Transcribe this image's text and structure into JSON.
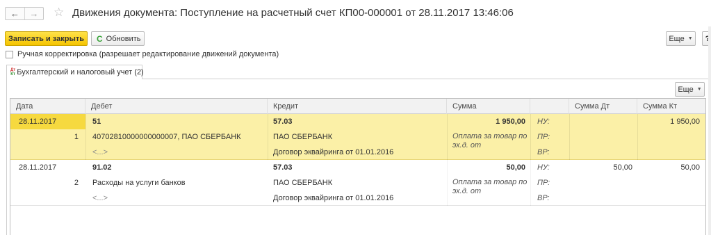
{
  "window": {
    "title": "Движения документа: Поступление на расчетный счет КП00-000001 от 28.11.2017 13:46:06"
  },
  "nav": {
    "back": "←",
    "forward": "→",
    "favorite": "☆"
  },
  "toolbar": {
    "save_close": "Записать и закрыть",
    "refresh": "Обновить",
    "more": "Еще",
    "help": "?"
  },
  "manual_edit": {
    "label": "Ручная корректировка (разрешает редактирование движений документа)",
    "checked": false
  },
  "tabs": [
    {
      "label": "Бухгалтерский и налоговый учет (2)",
      "icon": "accounting-dt-kt-icon",
      "icon_top": "Дт",
      "icon_bottom": "Кт"
    }
  ],
  "grid_toolbar": {
    "more": "Еще"
  },
  "columns": [
    "Дата",
    "Дебет",
    "Кредит",
    "Сумма",
    "",
    "Сумма Дт",
    "Сумма Кт"
  ],
  "rows": [
    {
      "date": "28.11.2017",
      "number": "1",
      "debit_account": "51",
      "debit_sub1": "40702810000000000007, ПАО СБЕРБАНК",
      "debit_sub2": "<...>",
      "credit_account": "57.03",
      "credit_sub1": "ПАО СБЕРБАНК",
      "credit_sub2": "Договор эквайринга от 01.01.2016",
      "amount": "1 950,00",
      "memo": "Оплата за товар по эх.д. от",
      "nu_label": "НУ:",
      "pr_label": "ПР:",
      "vr_label": "ВР:",
      "amount_dt": "",
      "amount_kt": "1 950,00",
      "selected": true
    },
    {
      "date": "28.11.2017",
      "number": "2",
      "debit_account": "91.02",
      "debit_sub1": "Расходы на услуги банков",
      "debit_sub2": "<...>",
      "credit_account": "57.03",
      "credit_sub1": "ПАО СБЕРБАНК",
      "credit_sub2": "Договор эквайринга от 01.01.2016",
      "amount": "50,00",
      "memo": "Оплата за товар по эх.д. от",
      "nu_label": "НУ:",
      "pr_label": "ПР:",
      "vr_label": "ВР:",
      "amount_dt": "50,00",
      "amount_kt": "50,00",
      "selected": false
    }
  ],
  "colors": {
    "primary_button": "#f5c400",
    "selected_row": "#fbf0a7",
    "selected_cell": "#f6d93f",
    "header_bg": "#f2f2f2"
  }
}
